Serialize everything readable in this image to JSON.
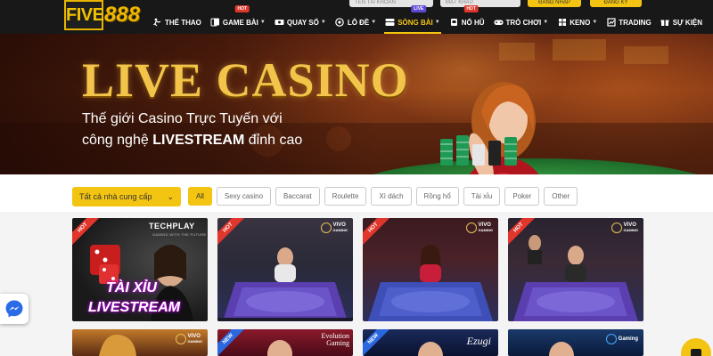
{
  "header": {
    "logo_text": "FIVE",
    "logo_number": "888",
    "username_placeholder": "TÊN TÀI KHOẢN",
    "password_placeholder": "MẬT KHẨU",
    "login_label": "ĐĂNG NHẬP",
    "register_label": "ĐĂNG KÝ"
  },
  "nav": {
    "items": [
      {
        "label": "THỂ THAO",
        "icon": "sports-icon",
        "caret": false,
        "badge": ""
      },
      {
        "label": "GAME BÀI",
        "icon": "cards-icon",
        "caret": true,
        "badge": "HOT"
      },
      {
        "label": "QUAY SỐ",
        "icon": "lottery-icon",
        "caret": true,
        "badge": ""
      },
      {
        "label": "LÔ ĐỀ",
        "icon": "lotto-icon",
        "caret": true,
        "badge": ""
      },
      {
        "label": "SÒNG BÀI",
        "icon": "casino-icon",
        "caret": true,
        "badge": "LIVE",
        "active": true
      },
      {
        "label": "NỔ HŨ",
        "icon": "slots-icon",
        "caret": false,
        "badge": "HOT"
      },
      {
        "label": "TRÒ CHƠI",
        "icon": "game-icon",
        "caret": true,
        "badge": ""
      },
      {
        "label": "KENO",
        "icon": "keno-icon",
        "caret": true,
        "badge": ""
      },
      {
        "label": "TRADING",
        "icon": "trading-icon",
        "caret": false,
        "badge": ""
      },
      {
        "label": "SỰ KIỆN",
        "icon": "event-icon",
        "caret": false,
        "badge": ""
      }
    ]
  },
  "banner": {
    "title": "LIVE CASINO",
    "subtitle_line1": "Thế giới Casino Trực Tuyến với",
    "subtitle_line2_prefix": "công nghệ ",
    "subtitle_line2_bold": "LIVESTREAM",
    "subtitle_line2_suffix": " đỉnh cao"
  },
  "filters": {
    "provider_label": "Tất cả nhà cung cấp",
    "categories": [
      "All",
      "Sexy casino",
      "Baccarat",
      "Roulette",
      "Xì dách",
      "Rồng hổ",
      "Tài xỉu",
      "Poker",
      "Other"
    ],
    "active_index": 0
  },
  "games": {
    "row1": [
      {
        "badge": "HOT",
        "provider": "TECHPLAY",
        "tagline": "GAMING WITH THE FUTURE",
        "title_line1": "TÀI XỈU",
        "title_line2": "LIVESTREAM"
      },
      {
        "badge": "HOT",
        "provider_line1": "VIVO",
        "provider_line2": "GAMING"
      },
      {
        "badge": "HOT",
        "provider_line1": "VIVO",
        "provider_line2": "GAMING"
      },
      {
        "badge": "HOT",
        "provider_line1": "VIVO",
        "provider_line2": "GAMING"
      }
    ],
    "row2": [
      {
        "badge": "",
        "provider_line1": "VIVO",
        "provider_line2": "GAMING"
      },
      {
        "badge": "NEW",
        "provider_line1": "Evolution",
        "provider_line2": "Gaming"
      },
      {
        "badge": "NEW",
        "provider_line1": "Ezugi",
        "provider_line2": ""
      },
      {
        "badge": "",
        "provider_line1": "Gaming",
        "provider_line2": ""
      }
    ]
  },
  "colors": {
    "accent_yellow": "#f3c411",
    "header_black": "#181818",
    "hot_red": "#e0362b",
    "new_blue": "#2b68e0"
  }
}
